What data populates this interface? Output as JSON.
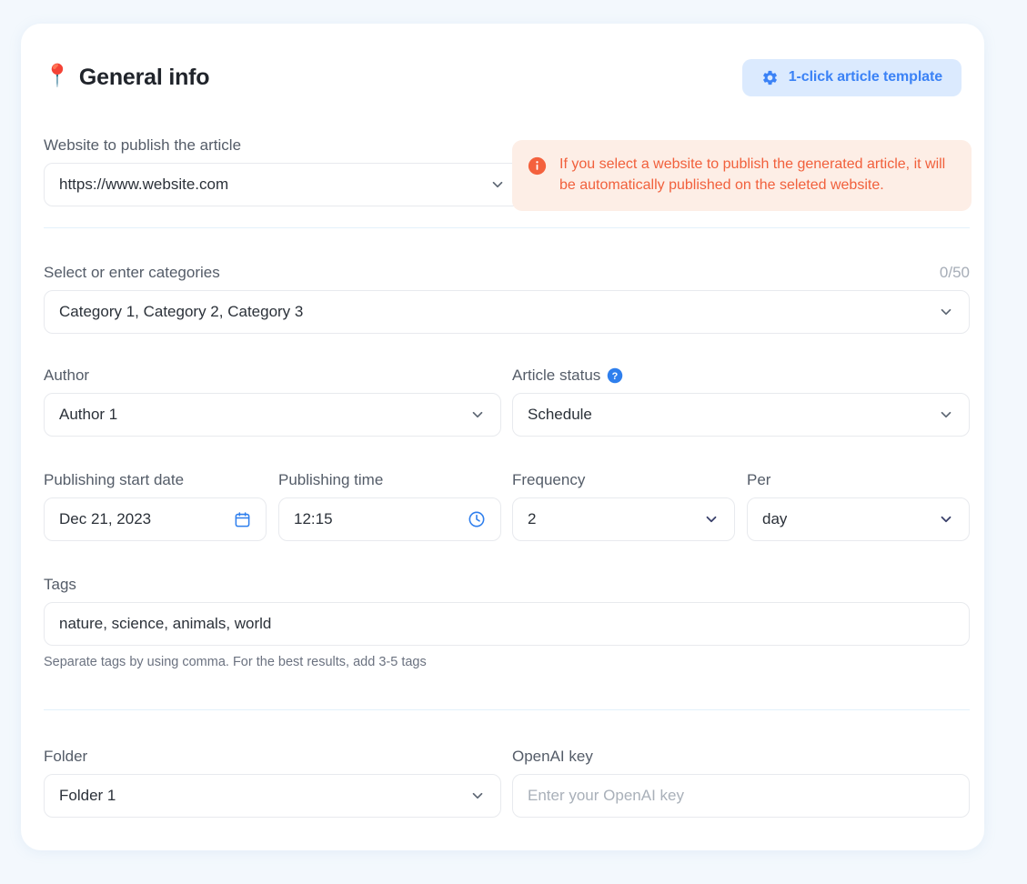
{
  "header": {
    "pin_icon": "pushpin-icon",
    "title": "General info",
    "template_button": {
      "label": "1-click article template",
      "icon": "gear-icon",
      "bg_color": "#dbeafe",
      "text_color": "#3b82f6"
    }
  },
  "website": {
    "label": "Website to publish the article",
    "value": "https://www.website.com",
    "chevron": "chevron-down-icon"
  },
  "warning": {
    "icon": "info-circle-icon",
    "message": "If you select a website to publish the generated article, it will be automatically published on the seleted website.",
    "bg_color": "#fdeee6",
    "text_color": "#f1603c"
  },
  "categories": {
    "label": "Select or enter categories",
    "counter": "0/50",
    "value": "Category 1, Category 2, Category 3",
    "chevron": "chevron-down-icon"
  },
  "author": {
    "label": "Author",
    "value": "Author 1",
    "chevron": "chevron-down-icon"
  },
  "article_status": {
    "label": "Article status",
    "help_icon": "question-mark-circle-icon",
    "value": "Schedule",
    "chevron": "chevron-down-icon"
  },
  "publishing_start_date": {
    "label": "Publishing start date",
    "value": "Dec 21, 2023",
    "icon": "calendar-icon"
  },
  "publishing_time": {
    "label": "Publishing time",
    "value": "12:15",
    "icon": "clock-icon"
  },
  "frequency": {
    "label": "Frequency",
    "value": "2",
    "chevron": "chevron-down-icon"
  },
  "per": {
    "label": "Per",
    "value": "day",
    "chevron": "chevron-down-icon"
  },
  "tags": {
    "label": "Tags",
    "value": "nature, science, animals, world",
    "helper": "Separate tags by using comma. For the best results, add 3-5 tags"
  },
  "folder": {
    "label": "Folder",
    "value": "Folder 1",
    "chevron": "chevron-down-icon"
  },
  "openai_key": {
    "label": "OpenAI key",
    "placeholder": "Enter your OpenAI key",
    "value": ""
  },
  "colors": {
    "accent_blue": "#3b82f6",
    "warning_orange": "#f1603c",
    "divider": "#e3f1fb",
    "page_bg": "#f3f8fd",
    "card_bg": "#ffffff"
  }
}
